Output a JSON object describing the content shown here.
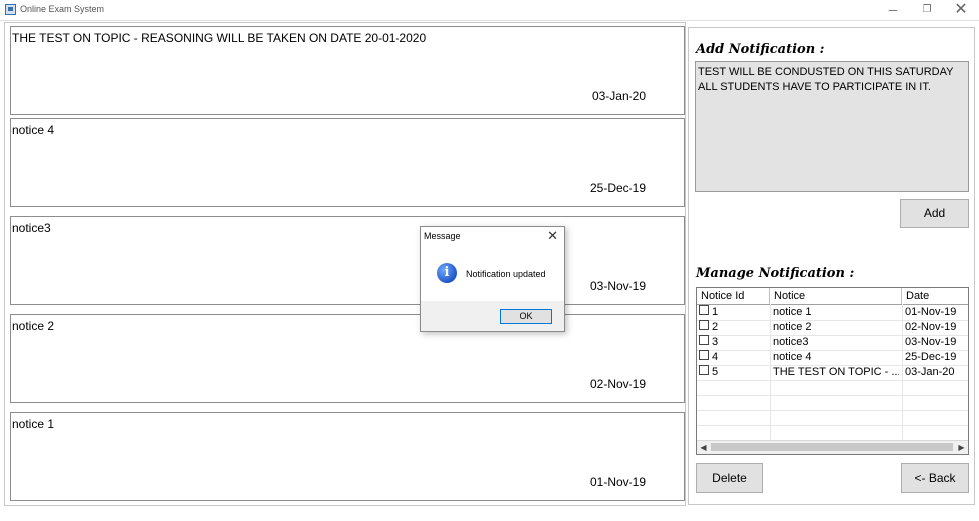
{
  "window": {
    "title": "Online Exam System",
    "minimize_glyph": "─",
    "maximize_glyph": "❐",
    "close_glyph": "✕"
  },
  "notices": [
    {
      "text": "THE TEST ON TOPIC - REASONING WILL BE TAKEN ON DATE 20-01-2020",
      "date": "03-Jan-20"
    },
    {
      "text": "notice 4",
      "date": "25-Dec-19"
    },
    {
      "text": "notice3",
      "date": "03-Nov-19"
    },
    {
      "text": "notice 2",
      "date": "02-Nov-19"
    },
    {
      "text": "notice 1",
      "date": "01-Nov-19"
    }
  ],
  "add_notification": {
    "title": "Add Notification :",
    "text": "TEST WILL BE CONDUSTED ON THIS SATURDAY ALL STUDENTS HAVE TO PARTICIPATE IN IT.",
    "add_label": "Add"
  },
  "manage_notification": {
    "title": "Manage Notification :",
    "columns": {
      "id": "Notice Id",
      "notice": "Notice",
      "date": "Date"
    },
    "rows": [
      {
        "id": "1",
        "notice": "notice 1",
        "date": "01-Nov-19"
      },
      {
        "id": "2",
        "notice": "notice 2",
        "date": "02-Nov-19"
      },
      {
        "id": "3",
        "notice": "notice3",
        "date": "03-Nov-19"
      },
      {
        "id": "4",
        "notice": "notice 4",
        "date": "25-Dec-19"
      },
      {
        "id": "5",
        "notice": "THE TEST ON TOPIC - ...",
        "date": "03-Jan-20"
      }
    ],
    "delete_label": "Delete",
    "back_label": "<- Back"
  },
  "dialog": {
    "title": "Message",
    "message": "Notification updated",
    "ok_label": "OK",
    "close_glyph": "✕",
    "icon_glyph": "i"
  }
}
